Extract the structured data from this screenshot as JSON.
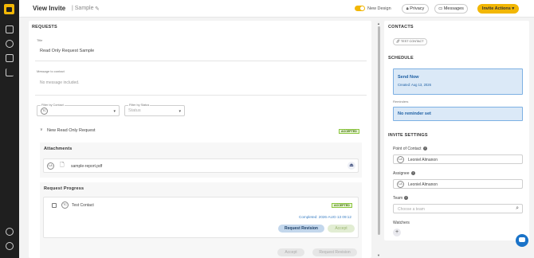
{
  "header": {
    "title": "View Invite",
    "subtitle": "Sample",
    "toggle_label": "New Design",
    "privacy_label": "Privacy",
    "messages_label": "Messages",
    "invite_actions_label": "Invite Actions"
  },
  "requests": {
    "section_title": "REQUESTS",
    "title_label": "Title",
    "title_value": "Read Only Request Sample",
    "message_label": "Message to contact",
    "message_value": "No message included.",
    "filter_contact_label": "Filter by Contact",
    "filter_contact_avatar": "TC",
    "filter_status_label": "Filter by Status",
    "filter_status_placeholder": "Status",
    "request_name": "New Read Only Request",
    "request_status": "ACCEPTED",
    "attachments_title": "Attachments",
    "attachment_avatar": "LA",
    "attachment_filename": "sample-report.pdf",
    "progress_title": "Request Progress",
    "contact_avatar": "TC",
    "contact_name": "Test Contact",
    "contact_status": "ACCEPTED",
    "completed_text": "Completed: 2026-AUG-13 09:12",
    "request_revision_label": "Request Revision",
    "accept_label": "Accept",
    "footer_accept_label": "Accept",
    "footer_revision_label": "Request Revision"
  },
  "contacts": {
    "section_title": "CONTACTS",
    "chip_label": "TEST CONTACT"
  },
  "schedule": {
    "section_title": "SCHEDULE",
    "send_title": "Send Now",
    "send_sub": "Created: Aug 13, 2026",
    "reminders_label": "Reminders",
    "reminder_value": "No reminder set"
  },
  "settings": {
    "section_title": "INVITE SETTINGS",
    "poc_label": "Point of Contact",
    "poc_avatar": "LA",
    "poc_value": "Leoniel Almanon",
    "assignee_label": "Assignee",
    "assignee_avatar": "LA",
    "assignee_value": "Leoniel Almanon",
    "team_label": "Team",
    "team_placeholder": "Choose a team",
    "watchers_label": "Watchers",
    "add_watcher": "+"
  },
  "icons": [
    "logo-icon",
    "inbox-icon",
    "chat-icon",
    "document-icon",
    "chart-icon",
    "settings-icon",
    "help-icon",
    "pencil-icon",
    "lock-icon",
    "chat-bubble-icon",
    "chevron-down-icon",
    "file-icon",
    "download-icon",
    "search-icon",
    "info-icon",
    "link-icon"
  ],
  "colors": {
    "accent": "#f2b705",
    "sidebar": "#1f1f1f",
    "accepted_bg": "#e8f5d6",
    "accepted_border": "#8cc63f",
    "schedule_blue": "#dbe9f7",
    "link_blue": "#1a73c8"
  }
}
